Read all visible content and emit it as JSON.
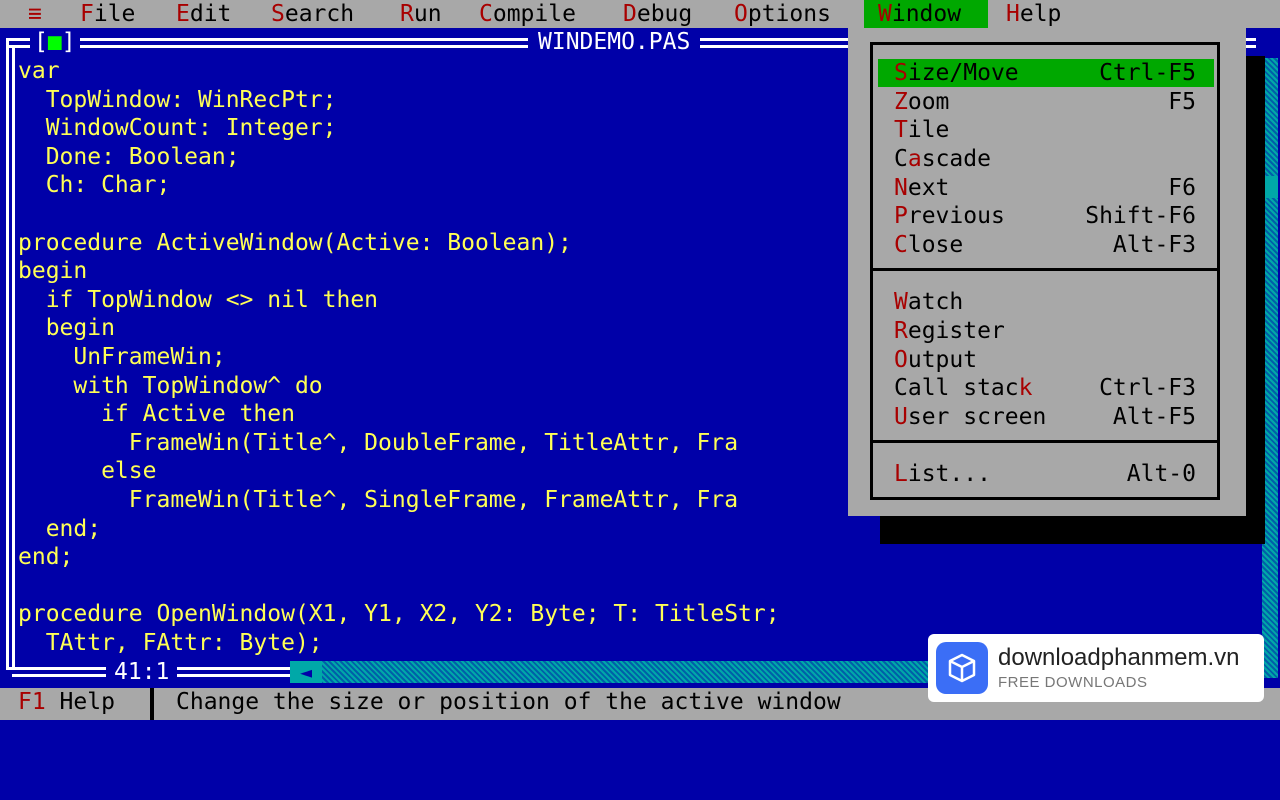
{
  "menubar": {
    "system": "≡",
    "items": [
      {
        "hk": "F",
        "rest": "ile"
      },
      {
        "hk": "E",
        "rest": "dit"
      },
      {
        "hk": "S",
        "rest": "earch"
      },
      {
        "hk": "R",
        "rest": "un"
      },
      {
        "hk": "C",
        "rest": "ompile"
      },
      {
        "hk": "D",
        "rest": "ebug"
      },
      {
        "hk": "O",
        "rest": "ptions"
      },
      {
        "hk": "W",
        "rest": "indow"
      },
      {
        "hk": "H",
        "rest": "elp"
      }
    ]
  },
  "editor": {
    "close_left": "[",
    "close_mark": "■",
    "close_right": "]",
    "title": "WINDEMO.PAS",
    "position": "41:1",
    "code": [
      "var",
      "  TopWindow: WinRecPtr;",
      "  WindowCount: Integer;",
      "  Done: Boolean;",
      "  Ch: Char;",
      "",
      "procedure ActiveWindow(Active: Boolean);",
      "begin",
      "  if TopWindow <> nil then",
      "  begin",
      "    UnFrameWin;",
      "    with TopWindow^ do",
      "      if Active then",
      "        FrameWin(Title^, DoubleFrame, TitleAttr, Fra",
      "      else",
      "        FrameWin(Title^, SingleFrame, FrameAttr, Fra",
      "  end;",
      "end;",
      "",
      "procedure OpenWindow(X1, Y1, X2, Y2: Byte; T: TitleStr;",
      "  TAttr, FAttr: Byte);"
    ]
  },
  "window_menu": {
    "groups": [
      [
        {
          "pre": "",
          "hk": "S",
          "post": "ize/Move",
          "shortcut": "Ctrl-F5",
          "selected": true
        },
        {
          "pre": "",
          "hk": "Z",
          "post": "oom",
          "shortcut": "F5"
        },
        {
          "pre": "",
          "hk": "T",
          "post": "ile",
          "shortcut": ""
        },
        {
          "pre": "C",
          "hk": "a",
          "post": "scade",
          "shortcut": ""
        },
        {
          "pre": "",
          "hk": "N",
          "post": "ext",
          "shortcut": "F6"
        },
        {
          "pre": "",
          "hk": "P",
          "post": "revious",
          "shortcut": "Shift-F6"
        },
        {
          "pre": "",
          "hk": "C",
          "post": "lose",
          "shortcut": "Alt-F3"
        }
      ],
      [
        {
          "pre": "",
          "hk": "W",
          "post": "atch",
          "shortcut": ""
        },
        {
          "pre": "",
          "hk": "R",
          "post": "egister",
          "shortcut": ""
        },
        {
          "pre": "",
          "hk": "O",
          "post": "utput",
          "shortcut": ""
        },
        {
          "pre": "Call stac",
          "hk": "k",
          "post": "",
          "shortcut": "Ctrl-F3"
        },
        {
          "pre": "",
          "hk": "U",
          "post": "ser screen",
          "shortcut": "Alt-F5"
        }
      ],
      [
        {
          "pre": "",
          "hk": "L",
          "post": "ist...",
          "shortcut": "Alt-0"
        }
      ]
    ]
  },
  "statusbar": {
    "key": "F1",
    "key_label": " Help",
    "message": "Change the size or position of the active window"
  },
  "watermark": {
    "site": "downloadphanmem.vn",
    "tagline": "FREE DOWNLOADS"
  },
  "colors": {
    "background": "#0000a8",
    "code_text": "#ffff55",
    "menu_bg": "#a8a8a8",
    "highlight": "#00a800",
    "hotkey": "#a80000"
  }
}
